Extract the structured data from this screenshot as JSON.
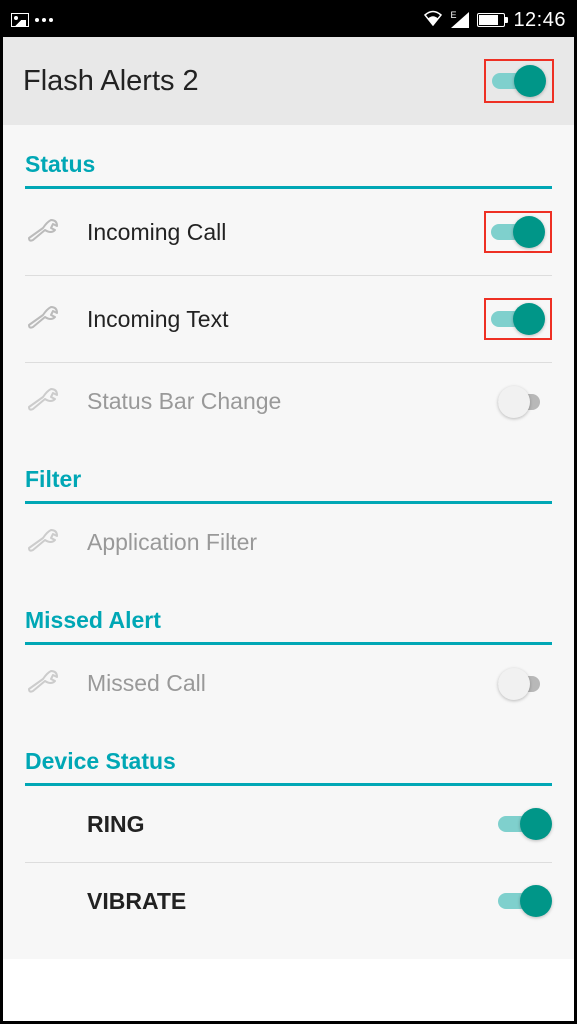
{
  "statusbar": {
    "time": "12:46",
    "network_type": "E"
  },
  "header": {
    "title": "Flash Alerts 2",
    "toggle_on": true
  },
  "sections": {
    "status": {
      "title": "Status",
      "items": [
        {
          "label": "Incoming Call",
          "toggle": "on",
          "highlighted": true,
          "disabled": false
        },
        {
          "label": "Incoming Text",
          "toggle": "on",
          "highlighted": true,
          "disabled": false
        },
        {
          "label": "Status Bar Change",
          "toggle": "off",
          "highlighted": false,
          "disabled": true
        }
      ]
    },
    "filter": {
      "title": "Filter",
      "items": [
        {
          "label": "Application Filter",
          "disabled": true
        }
      ]
    },
    "missed": {
      "title": "Missed Alert",
      "items": [
        {
          "label": "Missed Call",
          "toggle": "off",
          "highlighted": false,
          "disabled": true
        }
      ]
    },
    "device": {
      "title": "Device Status",
      "items": [
        {
          "label": "RING",
          "toggle": "on",
          "bold": true
        },
        {
          "label": "VIBRATE",
          "toggle": "on",
          "bold": true
        }
      ]
    }
  },
  "colors": {
    "accent": "#009688",
    "section_header": "#00a7b5",
    "highlight": "#ee3024"
  }
}
